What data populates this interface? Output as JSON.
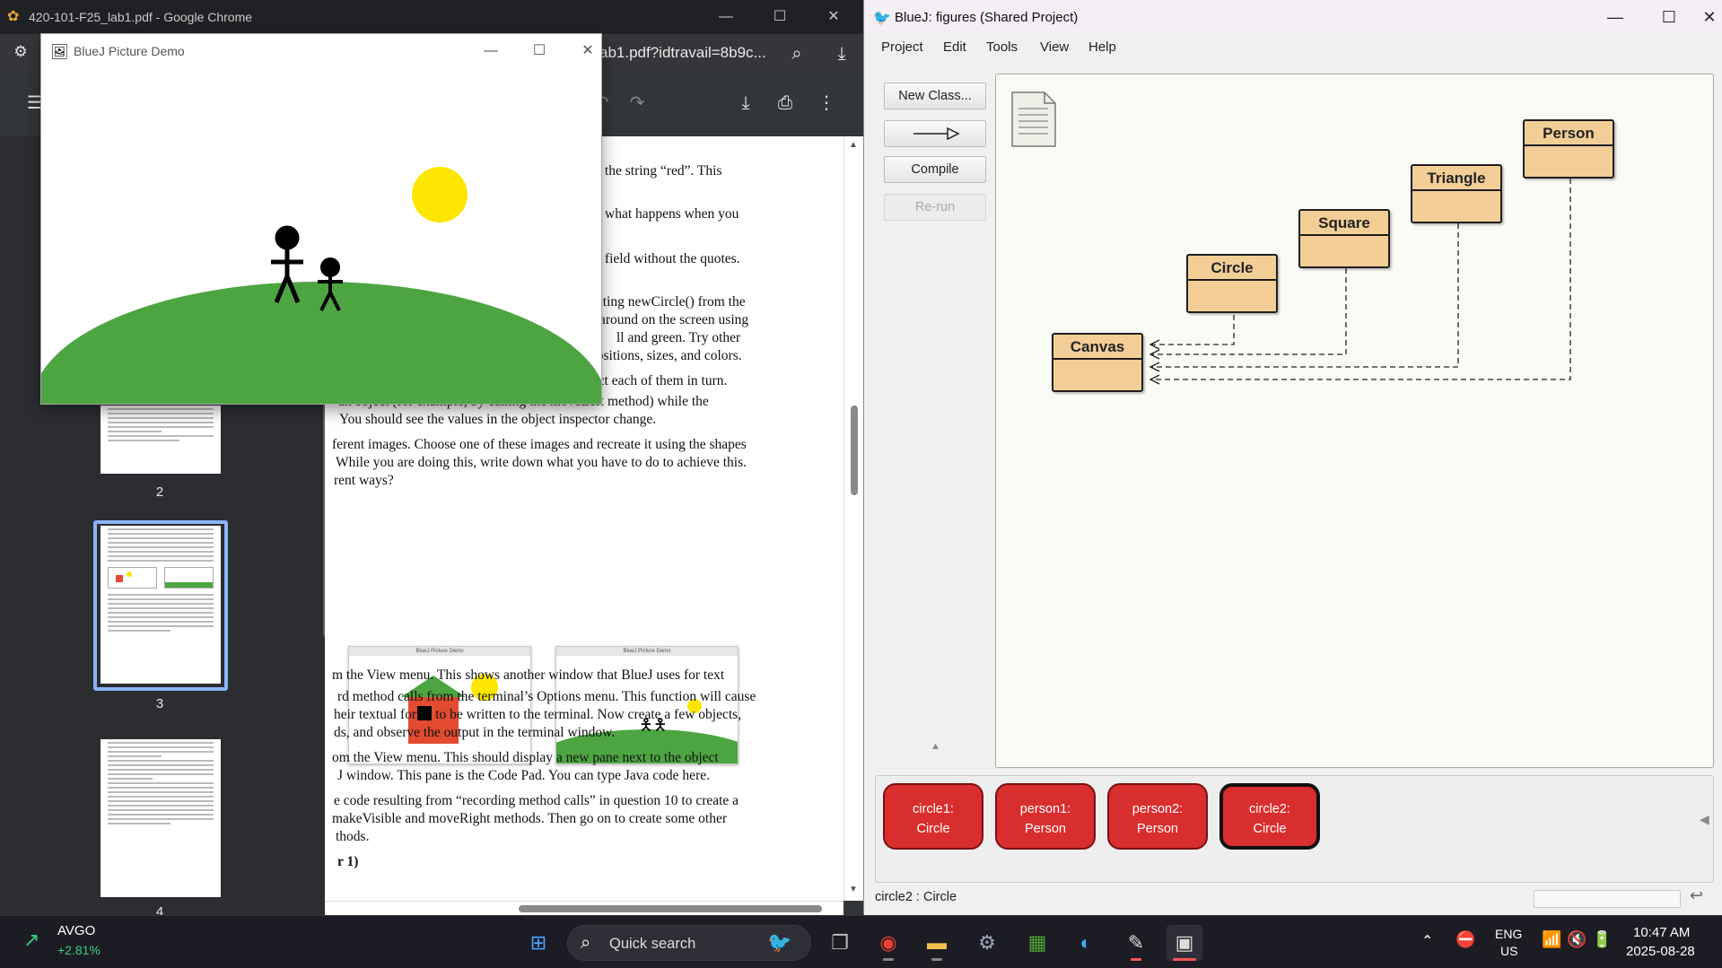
{
  "chrome": {
    "title": "420-101-F25_lab1.pdf - Google Chrome",
    "url_fragment": "ab1.pdf?idtravail=8b9c...",
    "thumb_numbers": [
      "2",
      "3",
      "4"
    ],
    "pdf_lines": [
      "er the string “red”. This",
      "what happens when you",
      "er field without the quotes.",
      "ecting newCircle() from the",
      "around on the screen using",
      "ll and green. Try other",
      "positions, sizes, and colors.",
      "pect each of them in turn.",
      "an object (for example, by calling the moveLeft method) while the",
      "You should see the values in the object inspector change.",
      "ferent images. Choose one of these images and recreate it using the shapes",
      "While you are doing this, write down what you have to do to achieve this.",
      "rent ways?",
      "m the View menu. This shows another window that BlueJ uses for text",
      "rd method calls from the terminal’s Options menu. This function will cause",
      "heir textual form) to be written to the terminal. Now create a few objects,",
      "ds, and observe the output in the terminal window.",
      "om the View menu. This should display a new pane next to the object",
      "J window. This pane is the Code Pad. You can type Java code here.",
      "e code resulting from “recording method calls” in question 10 to create a",
      "makeVisible and moveRight methods. Then go on to create some other",
      "thods.",
      "r 1)"
    ],
    "mini_title": "BlueJ Picture Demo"
  },
  "picdemo": {
    "title": "BlueJ Picture Demo",
    "colors": {
      "sun": "#ffe600",
      "hill": "#4da542",
      "figure": "#000000"
    }
  },
  "bluej": {
    "title": "BlueJ:  figures (Shared Project)",
    "menus": [
      "Project",
      "Edit",
      "Tools",
      "View",
      "Help"
    ],
    "buttons": {
      "new_class": "New Class...",
      "compile": "Compile",
      "rerun": "Re-run"
    },
    "classes": [
      "Person",
      "Triangle",
      "Square",
      "Circle",
      "Canvas"
    ],
    "objects": [
      {
        "name": "circle1:",
        "type": "Circle"
      },
      {
        "name": "person1:",
        "type": "Person"
      },
      {
        "name": "person2:",
        "type": "Person"
      },
      {
        "name": "circle2:",
        "type": "Circle"
      }
    ],
    "status": "circle2 : Circle",
    "colors": {
      "class_fill": "#f2ce96",
      "object_fill": "#d92e2e"
    }
  },
  "taskbar": {
    "stock_symbol": "AVGO",
    "stock_change": "+2.81%",
    "search_placeholder": "Quick search",
    "lang1": "ENG",
    "lang2": "US",
    "time": "10:47 AM",
    "date": "2025-08-28"
  }
}
